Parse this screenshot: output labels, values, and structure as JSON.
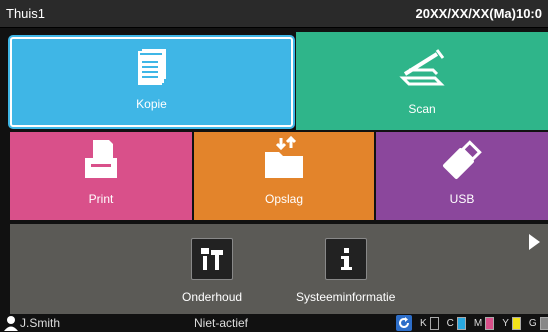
{
  "header": {
    "title": "Thuis1",
    "datetime": "20XX/XX/XX(Ma)10:0"
  },
  "tiles": {
    "kopie": {
      "label": "Kopie",
      "color": "#3fb6e6"
    },
    "scan": {
      "label": "Scan",
      "color": "#2fb58a"
    },
    "print": {
      "label": "Print",
      "color": "#d9508a"
    },
    "opslag": {
      "label": "Opslag",
      "color": "#e3842b"
    },
    "usb": {
      "label": "USB",
      "color": "#8b479c"
    }
  },
  "tools": {
    "onderhoud": {
      "label": "Onderhoud",
      "icon": "tools-icon"
    },
    "systeem": {
      "label": "Systeeminformatie",
      "icon": "info-icon"
    }
  },
  "status": {
    "user": "J.Smith",
    "state": "Niet-actief",
    "inks": [
      {
        "name": "K",
        "color": "#111111",
        "level": 0
      },
      {
        "name": "C",
        "color": "#29a8e0",
        "level": 1
      },
      {
        "name": "M",
        "color": "#d9508a",
        "level": 1
      },
      {
        "name": "Y",
        "color": "#f2e21a",
        "level": 1
      },
      {
        "name": "G",
        "color": "#888888",
        "level": 1
      }
    ]
  }
}
